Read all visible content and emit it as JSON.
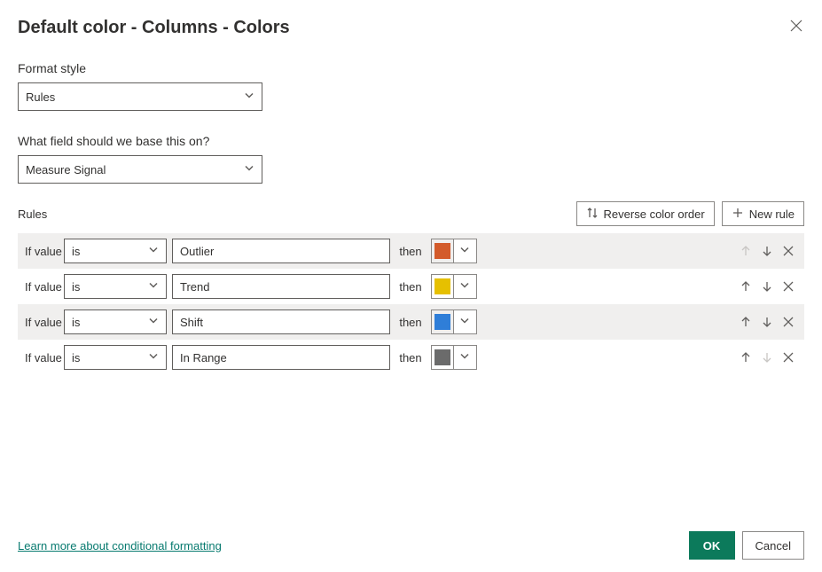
{
  "dialog": {
    "title": "Default color - Columns - Colors",
    "format_style_label": "Format style",
    "format_style_value": "Rules",
    "base_field_label": "What field should we base this on?",
    "base_field_value": "Measure Signal",
    "rules_label": "Rules",
    "reverse_label": "Reverse color order",
    "new_rule_label": "New rule",
    "learn_more": "Learn more about conditional formatting",
    "ok": "OK",
    "cancel": "Cancel"
  },
  "rule_row_labels": {
    "if_value": "If value",
    "then": "then"
  },
  "rules": [
    {
      "operator": "is",
      "value": "Outlier",
      "color": "#d35b2b",
      "up_enabled": false,
      "down_enabled": true,
      "alt": true
    },
    {
      "operator": "is",
      "value": "Trend",
      "color": "#e6c000",
      "up_enabled": true,
      "down_enabled": true,
      "alt": false
    },
    {
      "operator": "is",
      "value": "Shift",
      "color": "#2f7ed8",
      "up_enabled": true,
      "down_enabled": true,
      "alt": true
    },
    {
      "operator": "is",
      "value": "In Range",
      "color": "#6b6b6b",
      "up_enabled": true,
      "down_enabled": false,
      "alt": false
    }
  ]
}
